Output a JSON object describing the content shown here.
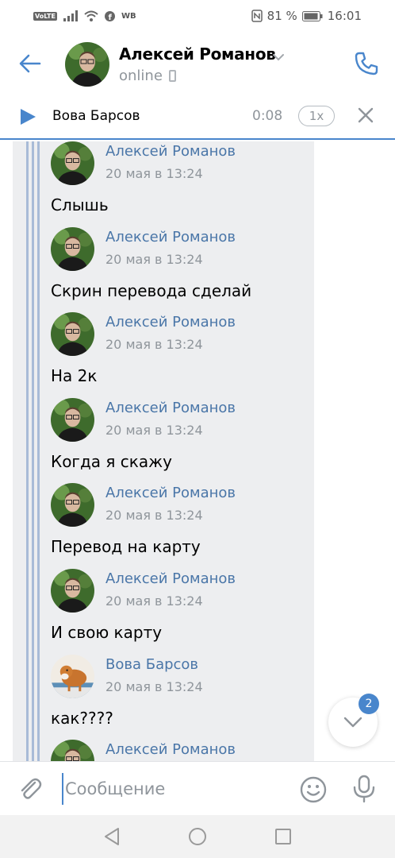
{
  "status_bar": {
    "volte": "VoLTE",
    "wb": "WB",
    "nfc": "N",
    "battery_percent": "81 %",
    "time": "16:01"
  },
  "header": {
    "contact_name": "Алексей Романов",
    "status": "online"
  },
  "player": {
    "track_title": "Вова Барсов",
    "duration": "0:08",
    "speed": "1x"
  },
  "messages": [
    {
      "author": "Алексей Романов",
      "date": "20 мая в 13:24",
      "text": "Слышь",
      "avatar": "alexey"
    },
    {
      "author": "Алексей Романов",
      "date": "20 мая в 13:24",
      "text": "Скрин перевода сделай",
      "avatar": "alexey"
    },
    {
      "author": "Алексей Романов",
      "date": "20 мая в 13:24",
      "text": "На 2к",
      "avatar": "alexey"
    },
    {
      "author": "Алексей Романов",
      "date": "20 мая в 13:24",
      "text": "Когда я скажу",
      "avatar": "alexey"
    },
    {
      "author": "Алексей Романов",
      "date": "20 мая в 13:24",
      "text": "Перевод на карту",
      "avatar": "alexey"
    },
    {
      "author": "Алексей Романов",
      "date": "20 мая в 13:24",
      "text": "И свою карту",
      "avatar": "alexey"
    },
    {
      "author": "Вова Барсов",
      "date": "20 мая в 13:24",
      "text": "как????",
      "avatar": "vova"
    },
    {
      "author": "Алексей Романов",
      "date": "",
      "text": "",
      "avatar": "alexey"
    }
  ],
  "scroll_down": {
    "unread_count": "2"
  },
  "composer": {
    "placeholder": "Сообщение"
  },
  "colors": {
    "accent": "#4986cc",
    "name_link": "#4a76a8",
    "secondary_text": "#8f959b",
    "forward_bg": "#edeef0"
  },
  "icons": {
    "back": "arrow-left-icon",
    "call": "phone-call-icon",
    "play": "play-icon",
    "close": "close-icon",
    "attach": "paperclip-icon",
    "emoji": "smile-icon",
    "mic": "microphone-icon",
    "scroll": "chevron-down-icon"
  }
}
